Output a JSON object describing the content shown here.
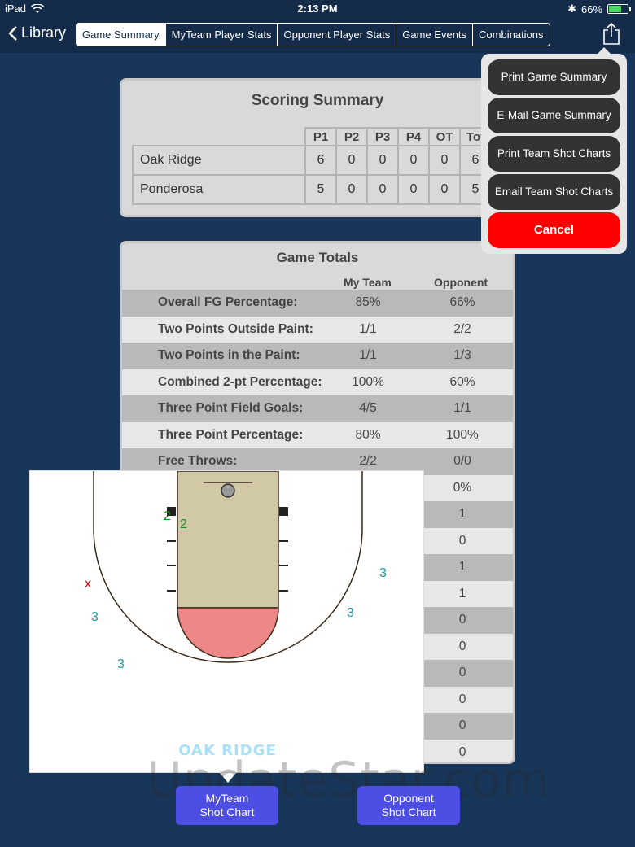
{
  "status": {
    "device": "iPad",
    "time": "2:13 PM",
    "battery": "66%"
  },
  "nav": {
    "back_label": "Library",
    "tabs": [
      "Game Summary",
      "MyTeam Player Stats",
      "Opponent Player Stats",
      "Game Events",
      "Combinations"
    ],
    "active_tab": 0
  },
  "scoring": {
    "title": "Scoring Summary",
    "headers": [
      "P1",
      "P2",
      "P3",
      "P4",
      "OT",
      "Tot"
    ],
    "rows": [
      {
        "team": "Oak Ridge",
        "values": [
          "6",
          "0",
          "0",
          "0",
          "0",
          "6"
        ]
      },
      {
        "team": "Ponderosa",
        "values": [
          "5",
          "0",
          "0",
          "0",
          "0",
          "5"
        ]
      }
    ]
  },
  "totals": {
    "title": "Game Totals",
    "col_my": "My Team",
    "col_opp": "Opponent",
    "rows": [
      {
        "label": "Overall FG Percentage:",
        "my": "85%",
        "opp": "66%"
      },
      {
        "label": "Two Points Outside Paint:",
        "my": "1/1",
        "opp": "2/2"
      },
      {
        "label": "Two Points in the Paint:",
        "my": "1/1",
        "opp": "1/3"
      },
      {
        "label": "Combined 2-pt Percentage:",
        "my": "100%",
        "opp": "60%"
      },
      {
        "label": "Three Point Field Goals:",
        "my": "4/5",
        "opp": "1/1"
      },
      {
        "label": "Three Point Percentage:",
        "my": "80%",
        "opp": "100%"
      },
      {
        "label": "Free Throws:",
        "my": "2/2",
        "opp": "0/0"
      },
      {
        "label": "",
        "my": "",
        "opp": "0%"
      },
      {
        "label": "",
        "my": "",
        "opp": "1"
      },
      {
        "label": "",
        "my": "",
        "opp": "0"
      },
      {
        "label": "",
        "my": "",
        "opp": "1"
      },
      {
        "label": "",
        "my": "",
        "opp": "1"
      },
      {
        "label": "",
        "my": "",
        "opp": "0"
      },
      {
        "label": "",
        "my": "",
        "opp": "0"
      },
      {
        "label": "",
        "my": "",
        "opp": "0"
      },
      {
        "label": "",
        "my": "",
        "opp": "0"
      },
      {
        "label": "",
        "my": "",
        "opp": "0"
      },
      {
        "label": "",
        "my": "",
        "opp": "0"
      }
    ]
  },
  "popover": {
    "items": [
      "Print Game Summary",
      "E-Mail Game Summary",
      "Print Team Shot Charts",
      "Email Team Shot Charts"
    ],
    "cancel": "Cancel"
  },
  "shot_chart": {
    "team_name": "OAK RIDGE",
    "marks": [
      {
        "label": "2",
        "color": "#1a8a1a"
      },
      {
        "label": "2",
        "color": "#1a8a1a"
      },
      {
        "label": "x",
        "color": "#cc0000"
      },
      {
        "label": "3",
        "color": "#1a9aa8"
      },
      {
        "label": "3",
        "color": "#1a9aa8"
      },
      {
        "label": "3",
        "color": "#1a9aa8"
      },
      {
        "label": "3",
        "color": "#1a9aa8"
      }
    ]
  },
  "buttons": {
    "my_team_line1": "MyTeam",
    "my_team_line2": "Shot Chart",
    "opponent_line1": "Opponent",
    "opponent_line2": "Shot Chart"
  },
  "watermark": "UpdateStar.com",
  "colors": {
    "background": "#18365a",
    "paint": "#d1c8a6",
    "restricted": "#ee8888",
    "cancel": "#fe0000",
    "chart_button": "#4c4ee4"
  }
}
